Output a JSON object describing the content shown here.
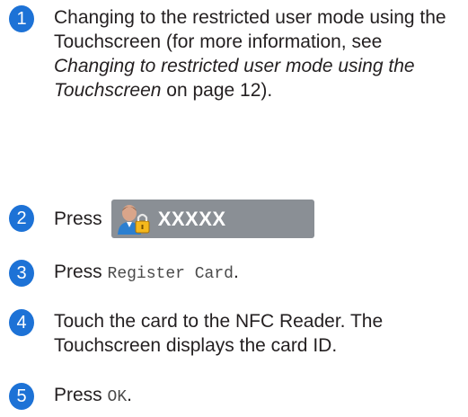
{
  "steps": [
    {
      "number": "1",
      "text_before": "Changing to the restricted user mode using the Touchscreen (for more information, see ",
      "text_italic": "Changing to restricted user mode using the Touchscreen",
      "text_after": " on page 12)."
    },
    {
      "number": "2",
      "text": "Press",
      "button_label": "XXXXX",
      "button_icon": "user-lock-icon"
    },
    {
      "number": "3",
      "text": "Press",
      "code": "Register Card",
      "text_after": "."
    },
    {
      "number": "4",
      "text": "Touch the card to the NFC Reader. The Touchscreen displays the card ID."
    },
    {
      "number": "5",
      "text": "Press",
      "code": "OK",
      "text_after": "."
    }
  ],
  "colors": {
    "step_badge": "#1d72d6",
    "button_bg": "#8a8f95",
    "text": "#231f20"
  }
}
